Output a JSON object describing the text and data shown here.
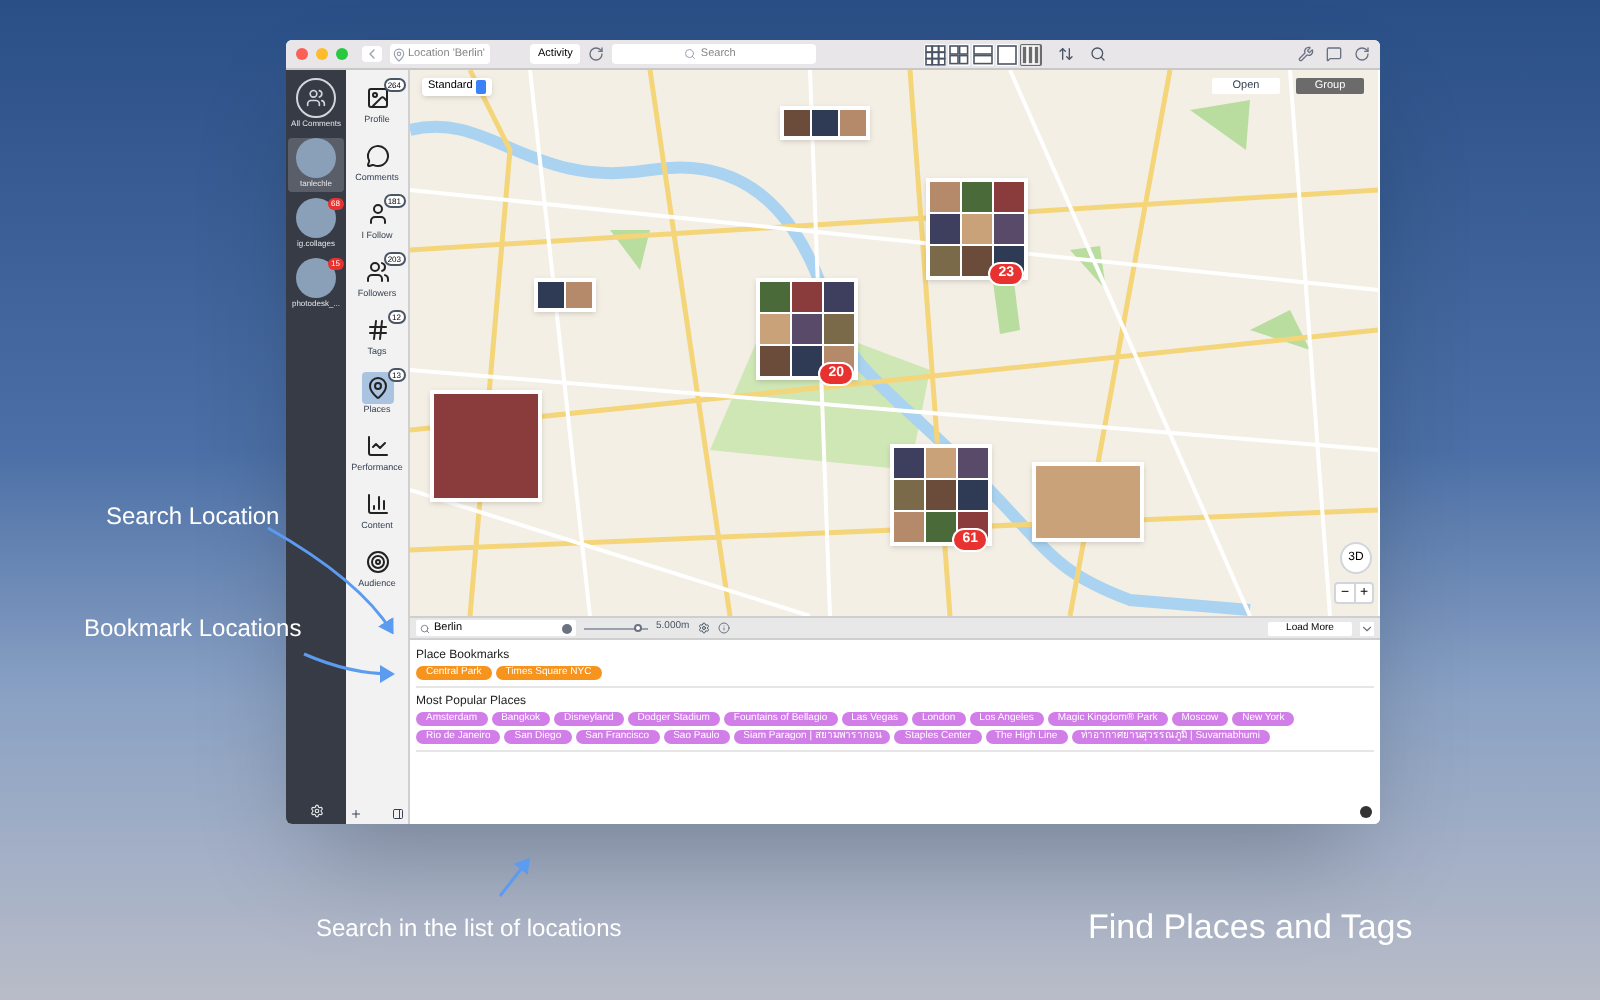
{
  "toolbar": {
    "location_placeholder": "Location 'Berlin'",
    "activity_button": "Activity",
    "search_placeholder": "Search",
    "view_modes": [
      {
        "selected": false
      },
      {
        "selected": false
      },
      {
        "selected": false
      },
      {
        "selected": false
      },
      {
        "selected": true
      }
    ]
  },
  "accounts": [
    {
      "name": "All Comments",
      "kind": "all",
      "selected": false
    },
    {
      "name": "tanlechle",
      "kind": "user",
      "selected": true
    },
    {
      "name": "ig.collages",
      "kind": "user",
      "selected": false,
      "badge": "68"
    },
    {
      "name": "photodesk_...",
      "kind": "user",
      "selected": false,
      "badge": "15"
    }
  ],
  "sections": [
    {
      "label": "Profile",
      "kind": "profile",
      "selected": false,
      "badge": "264"
    },
    {
      "label": "Comments",
      "kind": "comments",
      "selected": false
    },
    {
      "label": "I Follow",
      "kind": "following",
      "selected": false,
      "badge": "181"
    },
    {
      "label": "Followers",
      "kind": "followers",
      "selected": false,
      "badge": "203"
    },
    {
      "label": "Tags",
      "kind": "tags",
      "selected": false,
      "badge": "12"
    },
    {
      "label": "Places",
      "kind": "places",
      "selected": true,
      "badge": "13"
    },
    {
      "label": "Performance",
      "kind": "performance",
      "selected": false
    },
    {
      "label": "Content",
      "kind": "content",
      "selected": false
    },
    {
      "label": "Audience",
      "kind": "audience",
      "selected": false
    }
  ],
  "map": {
    "map_type": "Standard",
    "mode_buttons": [
      {
        "label": "Open",
        "selected": false
      },
      {
        "label": "Group",
        "selected": true
      }
    ],
    "clusters": [
      {
        "kind": "row"
      },
      {
        "kind": "pair"
      },
      {
        "kind": "grid",
        "count": "23"
      },
      {
        "kind": "grid",
        "count": "20"
      },
      {
        "kind": "single"
      },
      {
        "kind": "grid",
        "count": "61"
      },
      {
        "kind": "wide"
      }
    ],
    "view_3d": "3D",
    "zoom_out": "−",
    "zoom_in": "+"
  },
  "places_panel": {
    "search_value": "Berlin",
    "radius": {
      "level": 0.85
    },
    "radius_reading": "5.000m",
    "load_more": "Load More",
    "groups": [
      {
        "title": "Place Bookmarks",
        "color": "#f7941d",
        "places": [
          "Central Park",
          "Times Square NYC"
        ]
      },
      {
        "title": "Most Popular Places",
        "color": "#d17ee8",
        "places": [
          "Amsterdam",
          "Bangkok",
          "Disneyland",
          "Dodger Stadium",
          "Fountains of Bellagio",
          "Las Vegas",
          "London",
          "Los Angeles",
          "Magic Kingdom® Park",
          "Moscow",
          "New York",
          "Rio de Janeiro",
          "San Diego",
          "San Francisco",
          "Sao Paulo",
          "Siam Paragon | สยามพารากอน",
          "Staples Center",
          "The High Line",
          "ท่าอากาศยานสุวรรณภูมิ | Suvarnabhumi"
        ]
      }
    ]
  },
  "captions": [
    "Search Location",
    "Bookmark Locations",
    "Search in the list of locations",
    "Find Places and Tags"
  ]
}
